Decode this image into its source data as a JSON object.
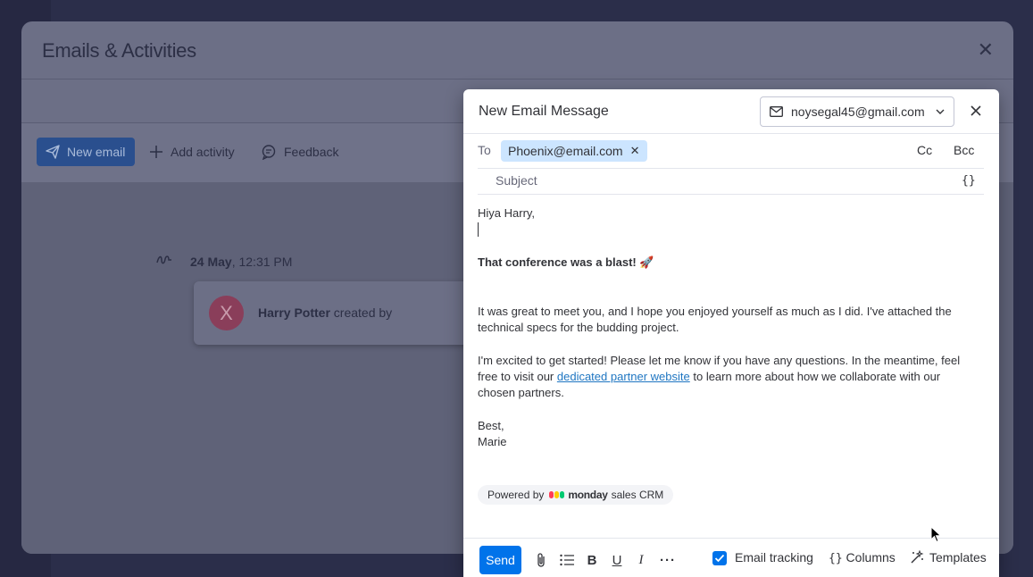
{
  "background_modal": {
    "title": "Emails & Activities",
    "toolbar": {
      "new_email": "New email",
      "add_activity": "Add activity",
      "feedback": "Feedback"
    },
    "timeline": {
      "date_bold": "24 May",
      "time": ", 12:31 PM",
      "card": {
        "avatar_letter": "X",
        "author": "Harry Potter",
        "action": " created by"
      }
    }
  },
  "composer": {
    "title": "New Email Message",
    "from_account": "noysegal45@gmail.com",
    "to_label": "To",
    "recipients": [
      "Phoenix@email.com"
    ],
    "cc_label": "Cc",
    "bcc_label": "Bcc",
    "subject_placeholder": "Subject",
    "variables_icon": "{}",
    "body": {
      "greeting": "Hiya Harry,",
      "headline": "That conference was a blast!",
      "headline_emoji": "🚀",
      "para1": "It was great to meet you, and I hope you enjoyed yourself as much as I did. I've attached the technical specs for the budding project.",
      "para2_start": "I'm excited to get started! Please let me know if you have any questions. In the meantime, feel free to visit our ",
      "para2_link": "dedicated partner website",
      "para2_end": " to learn more about how we collaborate with our chosen partners.",
      "signoff": "Best,",
      "signature": "Marie"
    },
    "powered_by": {
      "prefix": "Powered by",
      "brand": "monday",
      "suffix": "sales CRM",
      "logo_colors": [
        "#ff3d57",
        "#ffcb00",
        "#00ca72"
      ]
    },
    "footer": {
      "send": "Send",
      "email_tracking": "Email tracking",
      "email_tracking_checked": true,
      "columns": "Columns",
      "columns_icon": "{}",
      "templates": "Templates"
    }
  },
  "colors": {
    "accent": "#0073ea",
    "chip_bg": "#cce5ff",
    "link": "#1f76c2",
    "overlay_bg": "#6c6f86"
  }
}
